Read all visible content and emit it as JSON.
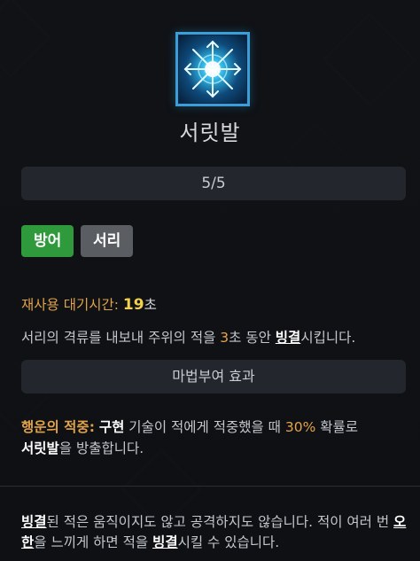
{
  "skill": {
    "icon": "frost-snowflake-icon",
    "name": "서릿발",
    "level": "5/5",
    "tags": [
      "방어",
      "서리"
    ],
    "tag_colors": [
      "#2f9a3b",
      "#5a5d62"
    ]
  },
  "cooldown": {
    "label": "재사용 대기시간:",
    "value": "19",
    "unit": "초"
  },
  "description": {
    "part1": "서리의 격류를 내보내 주위의 적을 ",
    "seconds": "3",
    "part2": "초 동안 ",
    "status": "빙결",
    "part3": "시킵니다."
  },
  "enchant": {
    "title": "마법부여 효과",
    "label": "행운의 적중:",
    "part1": " ",
    "skill_ref": "구현",
    "part2": " 기술이 적에게 적중했을 때 ",
    "chance": "30%",
    "part3": " 확률로",
    "result_skill": "서릿발",
    "part4": "을 방출합니다."
  },
  "note": {
    "term1": "빙결",
    "part1": "된 적은 움직이지도 않고 공격하지도 않습니다. 적이 여러 번 ",
    "term2": "오한",
    "part2": "을 느끼게 하면 적을 ",
    "term3": "빙결",
    "part3": "시킬 수 있습니다."
  },
  "colors": {
    "accent": "#e0a24a",
    "highlight": "#f2d24a",
    "background": "#101216"
  }
}
